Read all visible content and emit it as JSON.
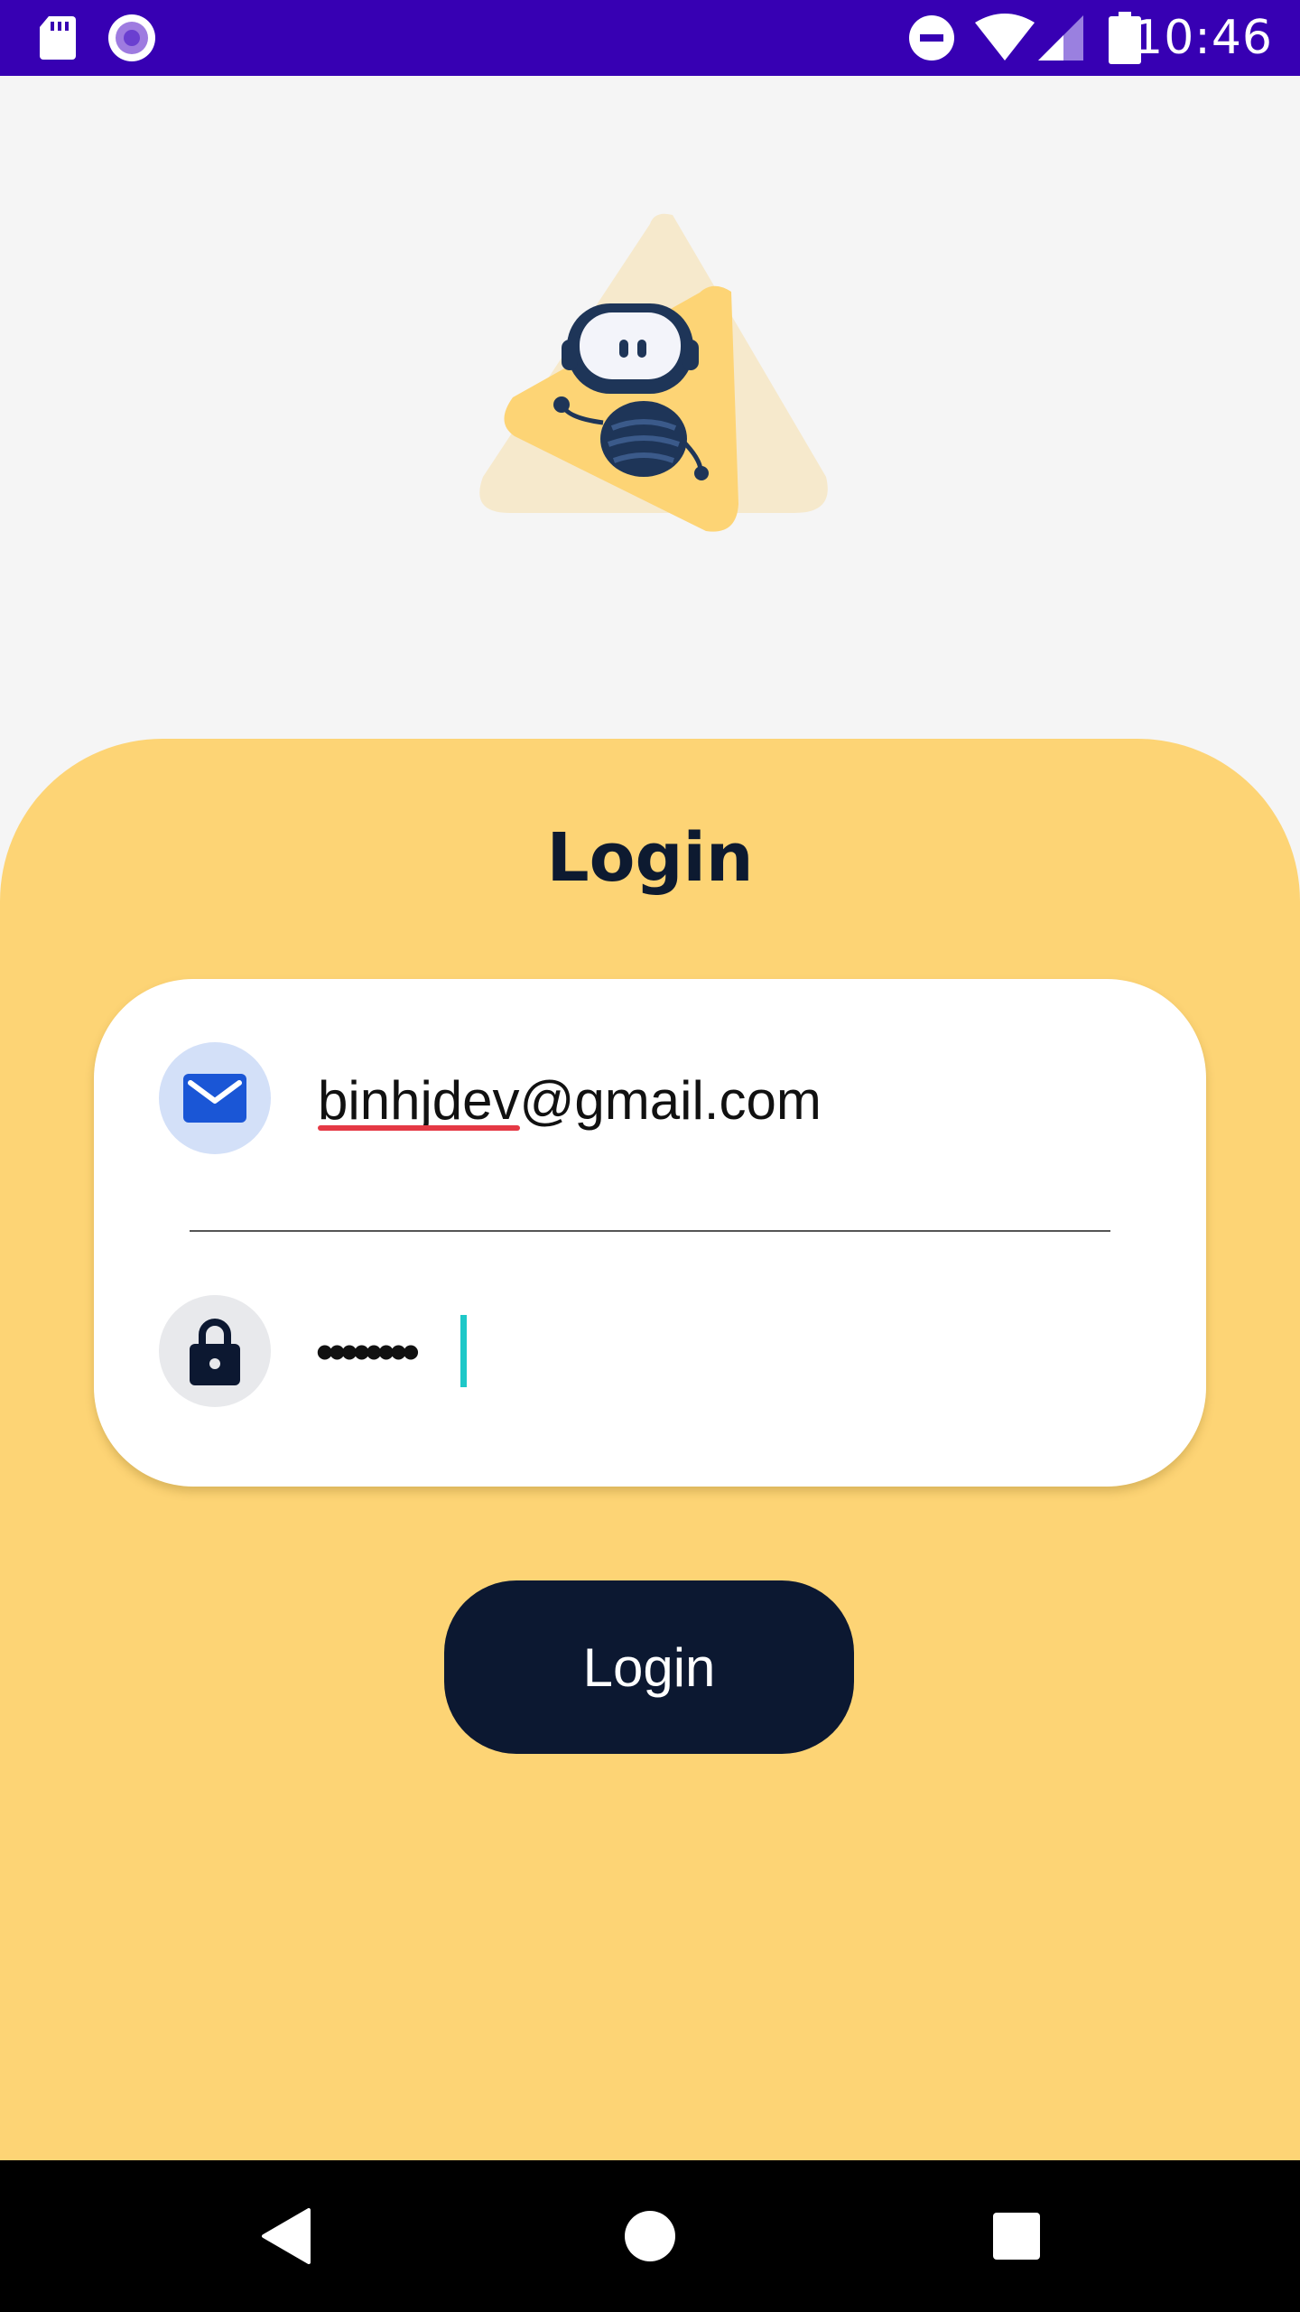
{
  "status_bar": {
    "time": "10:46",
    "icons": [
      "sd-card-icon",
      "record-icon",
      "do-not-disturb-icon",
      "wifi-icon",
      "signal-icon",
      "battery-icon"
    ],
    "background": "#3700b3"
  },
  "logo": {
    "name": "robot-logo"
  },
  "login": {
    "title": "Login",
    "email": {
      "icon": "mail-icon",
      "value": "binhjdev@gmail.com"
    },
    "password": {
      "icon": "lock-icon",
      "value": "••••••••"
    },
    "button_label": "Login"
  },
  "colors": {
    "sheet": "#fdd475",
    "button": "#0c1831",
    "title": "#0d1a30",
    "cursor": "#1ec8c8"
  },
  "nav_bar": {
    "buttons": [
      "back-icon",
      "home-icon",
      "recents-icon"
    ]
  }
}
